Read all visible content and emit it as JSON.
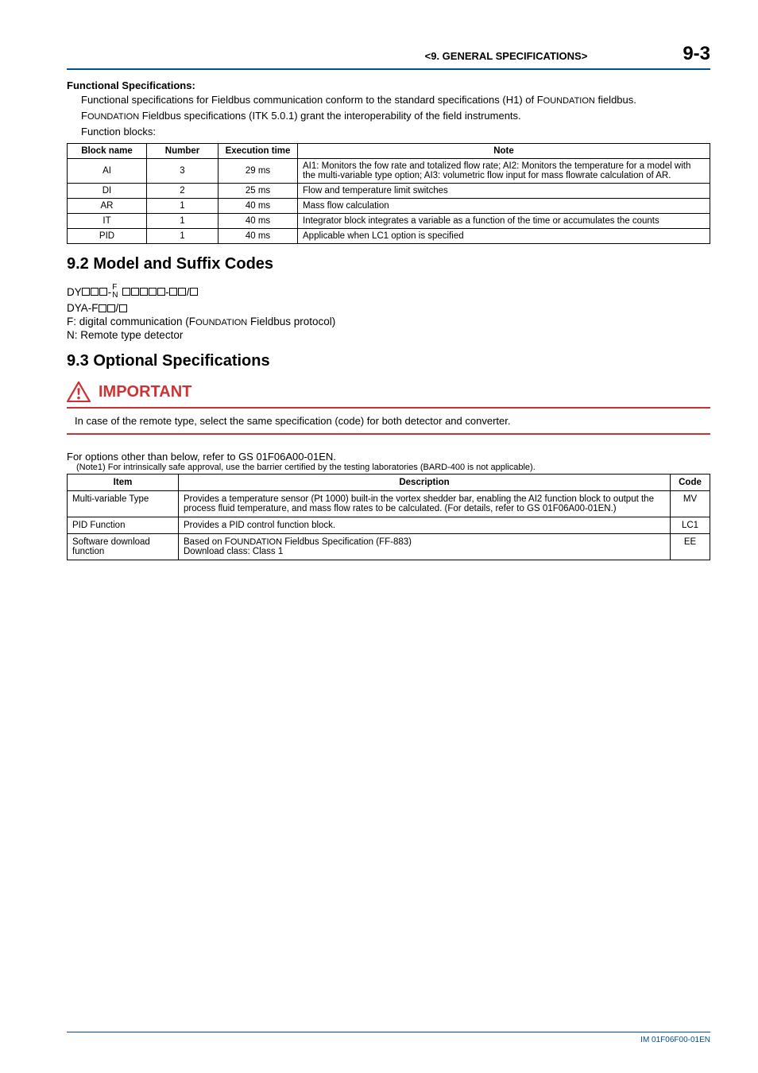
{
  "header": {
    "section": "<9.  GENERAL SPECIFICATIONS>",
    "page": "9-3"
  },
  "funcspec": {
    "heading": "Functional Specifications:",
    "p1a": "Functional specifications for Fieldbus communication conform to the standard specifications (H1) of F",
    "p1b": "OUNDATION",
    "p1c": " fieldbus.",
    "p2a": "F",
    "p2b": "OUNDATION",
    "p2c": " Fieldbus specifications (ITK 5.0.1) grant the interoperability of the field instruments.",
    "p3": "Function blocks:"
  },
  "blocks_table": {
    "headers": {
      "name": "Block name",
      "number": "Number",
      "exec": "Execution time",
      "note": "Note"
    },
    "rows": [
      {
        "name": "AI",
        "number": "3",
        "exec": "29 ms",
        "note": "AI1: Monitors the fow rate and totalized flow rate; AI2: Monitors the temperature for a model with the multi-variable type option; AI3: volumetric flow input for mass flowrate calculation of AR."
      },
      {
        "name": "DI",
        "number": "2",
        "exec": "25 ms",
        "note": "Flow and temperature limit switches"
      },
      {
        "name": "AR",
        "number": "1",
        "exec": "40 ms",
        "note": "Mass flow calculation"
      },
      {
        "name": "IT",
        "number": "1",
        "exec": "40 ms",
        "note": "Integrator block integrates a variable as a function of the time or accumulates the counts"
      },
      {
        "name": "PID",
        "number": "1",
        "exec": "40 ms",
        "note": "Applicable when LC1 option is specified"
      }
    ]
  },
  "s92": {
    "title": "9.2    Model and Suffix Codes",
    "line1_pre": "DY",
    "line1_dash": "-",
    "line1_F": "F",
    "line1_N": "N",
    "line1_sep": "-",
    "line1_slash": "/",
    "line2_pre": "DYA-F",
    "line2_slash": "/",
    "line3a": "F: digital communication (F",
    "line3b": "OUNDATION",
    "line3c": " Fieldbus protocol)",
    "line4": "N: Remote type detector"
  },
  "s93": {
    "title": "9.3    Optional Specifications",
    "important_label": "IMPORTANT",
    "important_text": "In case of the remote type, select the same specification (code) for both detector and converter.",
    "ref": "For options other than below, refer to GS 01F06A00-01EN.",
    "note1": "(Note1)   For intrinsically safe approval, use the barrier certified by the testing laboratories (BARD-400 is not applicable)."
  },
  "opts_table": {
    "headers": {
      "item": "Item",
      "desc": "Description",
      "code": "Code"
    },
    "rows": [
      {
        "item": "Multi-variable Type",
        "desc": "Provides a temperature sensor (Pt 1000) built-in the vortex shedder bar, enabling the AI2 function block to output the process fluid temperature, and mass flow rates to be calculated. (For details, refer to GS 01F06A00-01EN.)",
        "code": "MV"
      },
      {
        "item": "PID Function",
        "desc": "Provides a PID control function block.",
        "code": "LC1"
      },
      {
        "item": "Software download function",
        "desc_a": "Based on F",
        "desc_b": "OUNDATION",
        "desc_c": " Fieldbus Specification (FF-883)",
        "desc_d": "Download class: Class 1",
        "code": "EE"
      }
    ]
  },
  "footer": {
    "docnum": "IM 01F06F00-01EN"
  }
}
